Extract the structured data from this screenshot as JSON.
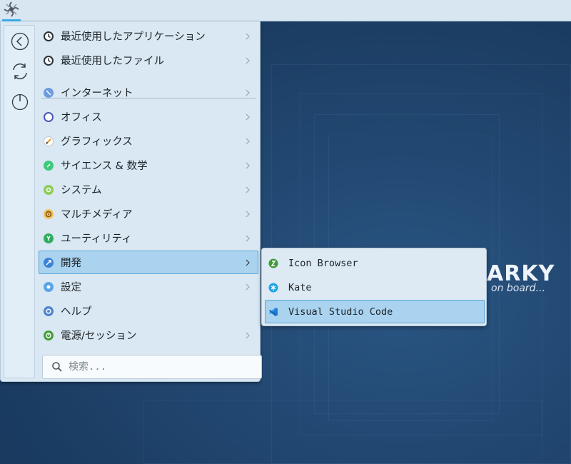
{
  "desktop": {
    "wallpaper_logo": "ARKY",
    "wallpaper_tagline": "on board..."
  },
  "panel": {
    "launcher_icon": "sparky-launcher-icon",
    "accent": "#3daee9"
  },
  "sidebar": {
    "buttons": [
      {
        "icon": "back-icon"
      },
      {
        "icon": "refresh-icon"
      },
      {
        "icon": "power-icon"
      }
    ]
  },
  "menu": {
    "items": [
      {
        "label": "最近使用したアプリケーション",
        "icon": "clock-icon",
        "submenu": true
      },
      {
        "label": "最近使用したファイル",
        "icon": "clock-icon",
        "submenu": true
      },
      {
        "label": "インターネット",
        "icon": "internet-icon",
        "submenu": true
      },
      {
        "label": "オフィス",
        "icon": "office-icon",
        "submenu": true
      },
      {
        "label": "グラフィックス",
        "icon": "graphics-icon",
        "submenu": true
      },
      {
        "label": "サイエンス & 数学",
        "icon": "science-icon",
        "submenu": true
      },
      {
        "label": "システム",
        "icon": "system-icon",
        "submenu": true
      },
      {
        "label": "マルチメディア",
        "icon": "multimedia-icon",
        "submenu": true
      },
      {
        "label": "ユーティリティ",
        "icon": "utilities-icon",
        "submenu": true
      },
      {
        "label": "開発",
        "icon": "development-icon",
        "submenu": true,
        "active": true
      },
      {
        "label": "設定",
        "icon": "settings-icon",
        "submenu": true
      },
      {
        "label": "ヘルプ",
        "icon": "help-icon",
        "submenu": false
      },
      {
        "label": "電源/セッション",
        "icon": "power-session-icon",
        "submenu": true
      }
    ]
  },
  "search": {
    "placeholder": "検索...",
    "value": ""
  },
  "submenu": {
    "items": [
      {
        "label": "Icon Browser",
        "icon": "icon-browser-icon"
      },
      {
        "label": "Kate",
        "icon": "kate-icon"
      },
      {
        "label": "Visual Studio Code",
        "icon": "vscode-icon",
        "active": true
      }
    ]
  }
}
